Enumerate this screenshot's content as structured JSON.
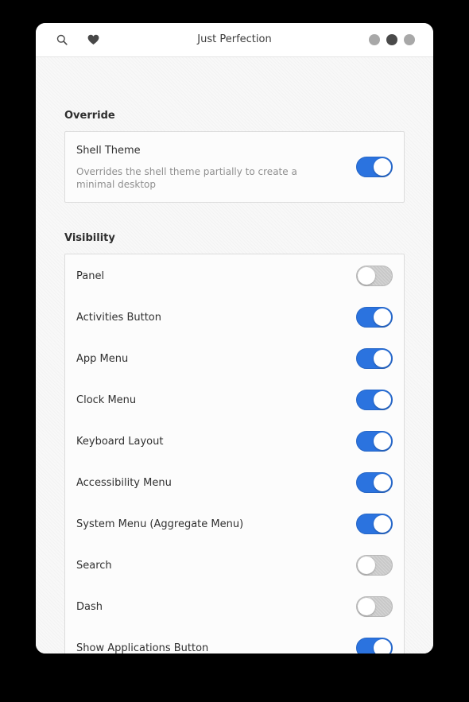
{
  "window": {
    "title": "Just Perfection",
    "header_icons": [
      "search-icon",
      "heart-icon"
    ],
    "controls": [
      "minimize-button",
      "maximize-button",
      "close-button"
    ]
  },
  "colors": {
    "accent": "#2b73df",
    "switch_off": "#c8c8c8",
    "background": "#f8f8f8"
  },
  "override": {
    "title": "Override",
    "rows": [
      {
        "label": "Shell Theme",
        "description": "Overrides the shell theme partially to create a minimal desktop",
        "on": true
      }
    ]
  },
  "visibility": {
    "title": "Visibility",
    "rows": [
      {
        "label": "Panel",
        "on": false
      },
      {
        "label": "Activities Button",
        "on": true
      },
      {
        "label": "App Menu",
        "on": true
      },
      {
        "label": "Clock Menu",
        "on": true
      },
      {
        "label": "Keyboard Layout",
        "on": true
      },
      {
        "label": "Accessibility Menu",
        "on": true
      },
      {
        "label": "System Menu (Aggregate Menu)",
        "on": true
      },
      {
        "label": "Search",
        "on": false
      },
      {
        "label": "Dash",
        "on": false
      },
      {
        "label": "Show Applications Button",
        "on": true
      }
    ]
  }
}
